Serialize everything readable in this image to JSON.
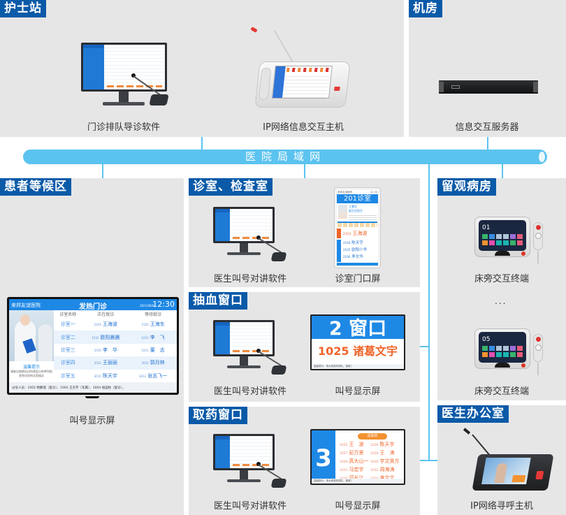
{
  "network": {
    "label": "医院局域网"
  },
  "zones": {
    "nurse_station": {
      "title": "护士站",
      "devices": [
        {
          "caption": "门诊排队导诊软件"
        },
        {
          "caption": "IP网络信息交互主机"
        }
      ]
    },
    "machine_room": {
      "title": "机房",
      "devices": [
        {
          "caption": "信息交互服务器"
        }
      ]
    },
    "waiting_area": {
      "title": "患者等候区",
      "devices": [
        {
          "caption": "叫号显示屏"
        }
      ],
      "display": {
        "hospital": "来邦友谊医院",
        "title": "发热门诊",
        "date": "2021/08/04",
        "time": "12:30",
        "columns": [
          "诊室名称",
          "正在就诊",
          "等待就诊"
        ],
        "rows": [
          {
            "room": "诊室一",
            "current_no": "2102",
            "current_name": "王海波",
            "next_no": "2103",
            "next_name": "王海东"
          },
          {
            "room": "诊室二",
            "current_no": "1032",
            "current_name": "欧阳晨晨",
            "next_no": "1033",
            "next_name": "李　飞"
          },
          {
            "room": "诊室三",
            "current_no": "1010",
            "current_name": "李　华",
            "next_no": "1011",
            "next_name": "董　志"
          },
          {
            "room": "诊室四",
            "current_no": "2022",
            "current_name": "王丽丽",
            "next_no": "2023",
            "next_name": "郭月林"
          },
          {
            "room": "诊室五",
            "current_no": "3011",
            "current_name": "陈天宇",
            "next_no": "3012",
            "next_name": "张志飞一"
          }
        ],
        "notice_title": "温馨提示",
        "notice_body": "请各位按照右边列表显示的呼叫信息到对应的诊室候诊",
        "footer": "过号人员：1002 杨鹏瑞（复诊）、1003 王天宇（军属）、1004 张国柱（复诊）。"
      }
    },
    "clinic_exam": {
      "title": "诊室、检查室",
      "devices": [
        {
          "caption": "医生叫号对讲软件"
        },
        {
          "caption": "诊室门口屏"
        }
      ],
      "door_screen": {
        "hospital": "来邦友谊医院",
        "time": "12:30",
        "room": "201诊室",
        "doctor": "王慧文",
        "doctor_title": "副主任医生",
        "calling_label": "就诊",
        "calling": {
          "no": "2103",
          "name": "王海波"
        },
        "waiting_label": "等待",
        "waiting": [
          {
            "no": "2104",
            "name": "陈天宇"
          },
          {
            "no": "2105",
            "name": "欧阳少华"
          },
          {
            "no": "2106",
            "name": "李文华"
          }
        ]
      }
    },
    "blood_window": {
      "title": "抽血窗口",
      "devices": [
        {
          "caption": "医生叫号对讲软件"
        },
        {
          "caption": "叫号显示屏"
        }
      ],
      "screen": {
        "window": "2 窗口",
        "call_no": "1025",
        "call_name": "诸葛文宇",
        "footer": "温馨提示：请大家按序排队，谢谢！"
      }
    },
    "pharmacy_window": {
      "title": "取药窗口",
      "devices": [
        {
          "caption": "医生叫号对讲软件"
        },
        {
          "caption": "叫号显示屏"
        }
      ],
      "screen": {
        "window_no": "3",
        "banner": "请取药",
        "entries": [
          {
            "no": "1025",
            "name": "王　波"
          },
          {
            "no": "1026",
            "name": "陈天宇"
          },
          {
            "no": "1027",
            "name": "彭万里"
          },
          {
            "no": "1028",
            "name": "王　涛"
          },
          {
            "no": "1029",
            "name": "高大山一"
          },
          {
            "no": "1030",
            "name": "宇文昊方"
          },
          {
            "no": "1031",
            "name": "马宏宇"
          },
          {
            "no": "1032",
            "name": "周海涛"
          },
          {
            "no": "1033",
            "name": "范长江"
          },
          {
            "no": "1034",
            "name": "李文文"
          }
        ],
        "footer": "温馨提示：请大家按序排队，谢谢！"
      }
    },
    "observation_ward": {
      "title": "留观病房",
      "devices": [
        {
          "caption": "床旁交互终端",
          "bed_no": "01"
        },
        {
          "caption": "床旁交互终端",
          "bed_no": "05"
        }
      ],
      "ellipsis": "..."
    },
    "doctor_office": {
      "title": "医生办公室",
      "devices": [
        {
          "caption": "IP网络寻呼主机"
        }
      ]
    }
  },
  "colors": {
    "tag_bg": "#0a5aa8",
    "lan": "#5bc3ef",
    "panel_bg": "#e6e6e6",
    "screen_blue": "#1e88e5",
    "accent_orange": "#f0642a"
  }
}
